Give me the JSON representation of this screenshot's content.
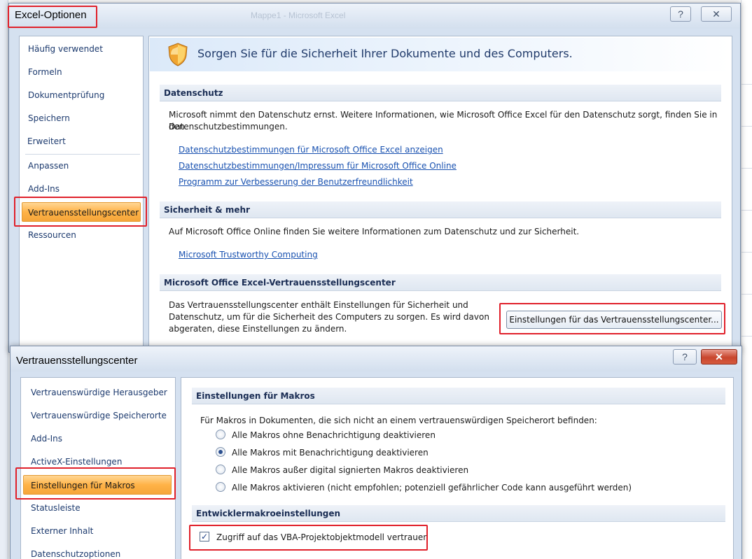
{
  "background": {
    "faded_title": "Mappe1 - Microsoft Excel"
  },
  "excel_options": {
    "title": "Excel-Optionen",
    "help_glyph": "?",
    "close_glyph": "✕",
    "nav": [
      "Häufig verwendet",
      "Formeln",
      "Dokumentprüfung",
      "Speichern",
      "Erweitert",
      "Anpassen",
      "Add-Ins",
      "Vertrauensstellungscenter",
      "Ressourcen"
    ],
    "selected_nav_index": 7,
    "banner": "Sorgen Sie für die Sicherheit Ihrer Dokumente und des Computers.",
    "privacy": {
      "heading": "Datenschutz",
      "text_line1": "Microsoft nimmt den Datenschutz ernst. Weitere Informationen, wie Microsoft Office Excel für den Datenschutz sorgt, finden Sie in den",
      "text_line2": "Datenschutzbestimmungen.",
      "links": [
        "Datenschutzbestimmungen für Microsoft Office Excel anzeigen",
        "Datenschutzbestimmungen/Impressum für Microsoft Office Online",
        "Programm zur Verbesserung der Benutzerfreundlichkeit"
      ]
    },
    "security": {
      "heading": "Sicherheit & mehr",
      "text": "Auf Microsoft Office Online finden Sie weitere Informationen zum Datenschutz und zur Sicherheit.",
      "link": "Microsoft Trustworthy Computing"
    },
    "trust_center": {
      "heading": "Microsoft Office Excel-Vertrauensstellungscenter",
      "text_line1": "Das Vertrauensstellungscenter enthält Einstellungen für Sicherheit und",
      "text_line2": "Datenschutz, um für die Sicherheit des Computers zu sorgen. Es wird davon",
      "text_line3": "abgeraten, diese Einstellungen zu ändern.",
      "button": "Einstellungen für das Vertrauensstellungscenter..."
    }
  },
  "trust_center_dialog": {
    "title": "Vertrauensstellungscenter",
    "help_glyph": "?",
    "close_glyph": "✕",
    "nav": [
      "Vertrauenswürdige Herausgeber",
      "Vertrauenswürdige Speicherorte",
      "Add-Ins",
      "ActiveX-Einstellungen",
      "Einstellungen für Makros",
      "Statusleiste",
      "Externer Inhalt",
      "Datenschutzoptionen"
    ],
    "selected_nav_index": 4,
    "macro_section": {
      "heading": "Einstellungen für Makros",
      "intro": "Für Makros in Dokumenten, die sich nicht an einem vertrauenswürdigen Speicherort befinden:",
      "options": [
        "Alle Makros ohne Benachrichtigung deaktivieren",
        "Alle Makros mit Benachrichtigung deaktivieren",
        "Alle Makros außer digital signierten Makros deaktivieren",
        "Alle Makros aktivieren (nicht empfohlen; potenziell gefährlicher Code kann ausgeführt werden)"
      ],
      "selected_option_index": 1
    },
    "developer_section": {
      "heading": "Entwicklermakroeinstellungen",
      "checkbox_label": "Zugriff auf das VBA-Projektobjektmodell vertrauen",
      "checkbox_checked": true,
      "check_glyph": "✓"
    }
  },
  "colors": {
    "highlight_red": "#e0202a",
    "selected_orange": "#ffb347",
    "link_blue": "#1851b0"
  }
}
